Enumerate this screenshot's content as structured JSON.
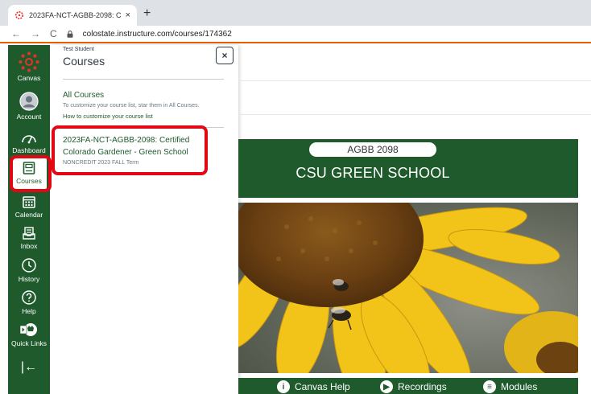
{
  "browser": {
    "tab_title": "2023FA-NCT-AGBB-2098: Certifi",
    "tab_close": "×",
    "new_tab": "+",
    "back": "←",
    "forward": "→",
    "reload": "C",
    "url": "colostate.instructure.com/courses/174362"
  },
  "global_nav": {
    "items": [
      {
        "label": "Canvas",
        "icon": "canvas-logo-icon"
      },
      {
        "label": "Account",
        "icon": "avatar-icon"
      },
      {
        "label": "Dashboard",
        "icon": "dashboard-icon"
      },
      {
        "label": "Courses",
        "icon": "courses-icon"
      },
      {
        "label": "Calendar",
        "icon": "calendar-icon"
      },
      {
        "label": "Inbox",
        "icon": "inbox-icon"
      },
      {
        "label": "History",
        "icon": "history-icon"
      },
      {
        "label": "Help",
        "icon": "help-icon"
      },
      {
        "label": "Quick Links",
        "icon": "quick-links-icon"
      }
    ],
    "collapse": "|←"
  },
  "tray": {
    "user": "Test Student",
    "title": "Courses",
    "close": "×",
    "all_courses": "All Courses",
    "customize_text": "To customize your course list, star them in All Courses.",
    "customize_link": "How to customize your course list",
    "course_name": "2023FA-NCT-AGBB-2098: Certified Colorado Gardener - Green School",
    "course_term": "NONCREDIT 2023 FALL Term"
  },
  "banner": {
    "code": "AGBB 2098",
    "title": "CSU GREEN SCHOOL"
  },
  "bottom_links": [
    {
      "label": "Canvas Help",
      "icon": "info-icon",
      "glyph": "i"
    },
    {
      "label": "Recordings",
      "icon": "play-icon",
      "glyph": "▶"
    },
    {
      "label": "Modules",
      "icon": "list-icon",
      "glyph": "≡"
    }
  ],
  "colors": {
    "brand": "#1f5a2c",
    "highlight": "#e30613",
    "accent": "#e66000"
  }
}
